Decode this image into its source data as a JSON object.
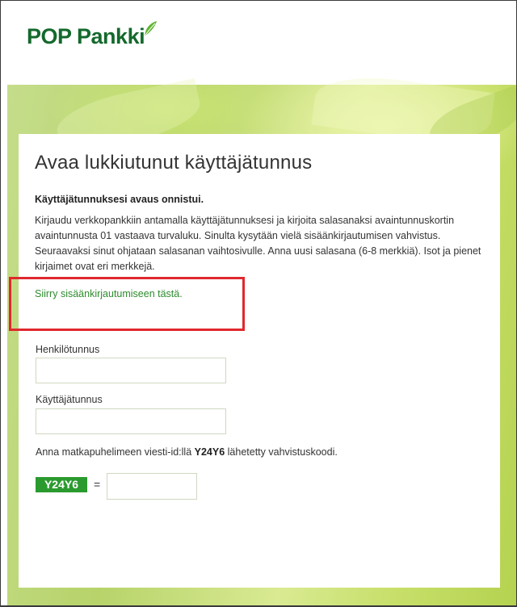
{
  "brand": {
    "logo_text": "POP Pankki",
    "color": "#14692c"
  },
  "page": {
    "title": "Avaa lukkiutunut käyttäjätunnus",
    "success_message": "Käyttäjätunnuksesi avaus onnistui.",
    "instructions": "Kirjaudu verkkopankkiin antamalla käyttäjätunnuksesi ja kirjoita salasanaksi avaintunnuskortin avaintunnusta 01 vastaava turvaluku. Sinulta kysytään vielä sisäänkirjautumisen vahvistus. Seuraavaksi sinut ohjataan salasanan vaihtosivulle. Anna uusi salasana (6-8 merkkiä). Isot ja pienet kirjaimet ovat eri merkkejä.",
    "login_link": "Siirry sisäänkirjautumiseen tästä."
  },
  "form": {
    "henkilotunnus_label": "Henkilötunnus",
    "henkilotunnus_value": "",
    "kayttajatunnus_label": "Käyttäjätunnus",
    "kayttajatunnus_value": "",
    "sms_prefix": "Anna matkapuhelimeen viesti-id:llä ",
    "sms_id": "Y24Y6",
    "sms_suffix": " lähetetty vahvistuskoodi.",
    "code_badge": "Y24Y6",
    "equals": "=",
    "code_value": ""
  },
  "colors": {
    "link": "#2e8b2e",
    "badge": "#2b9a2e",
    "annotation": "#e0282e"
  },
  "icons": [
    "leaf-icon"
  ]
}
